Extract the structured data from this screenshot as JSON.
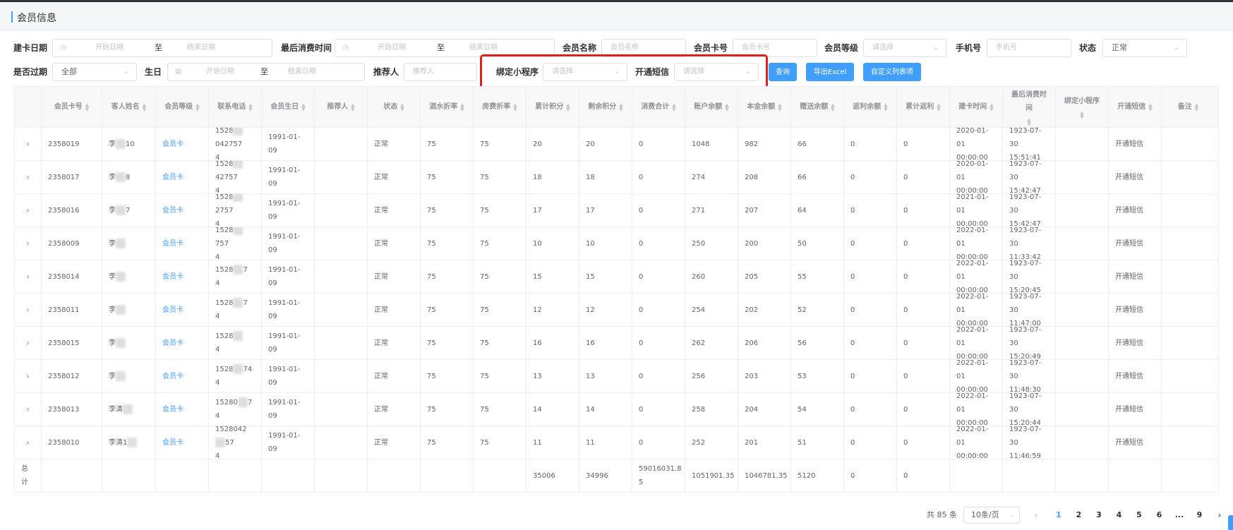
{
  "page": {
    "title": "会员信息"
  },
  "filters": {
    "card_date": {
      "label": "建卡日期",
      "start": "开始日期",
      "sep": "至",
      "end": "结束日期"
    },
    "last_consume": {
      "label": "最后消费时间",
      "start": "开始日期",
      "sep": "至",
      "end": "结束日期"
    },
    "member_name": {
      "label": "会员名称",
      "placeholder": "会员名称"
    },
    "card_no": {
      "label": "会员卡号",
      "placeholder": "会员卡号"
    },
    "level": {
      "label": "会员等级",
      "placeholder": "请选择"
    },
    "phone": {
      "label": "手机号",
      "placeholder": "手机号"
    },
    "status": {
      "label": "状态",
      "value": "正常"
    },
    "expired": {
      "label": "是否过期",
      "value": "全部"
    },
    "birthday": {
      "label": "生日",
      "start": "开始日期",
      "sep": "至",
      "end": "结束日期"
    },
    "referrer": {
      "label": "推荐人",
      "placeholder": "推荐人"
    },
    "mini_program": {
      "label": "绑定小程序",
      "placeholder": "请选择"
    },
    "sms": {
      "label": "开通短信",
      "placeholder": "请选择"
    }
  },
  "buttons": {
    "query": "查询",
    "export": "导出Excel",
    "custom_cols": "自定义列表项"
  },
  "table": {
    "headers": {
      "card_no": "会员卡号",
      "name": "客人姓名",
      "level": "会员等级",
      "phone": "联系电话",
      "birthday": "会员生日",
      "referrer": "推荐人",
      "status": "状态",
      "drink_discount": "酒水折率",
      "room_discount": "房费折率",
      "points_total": "累计积分",
      "points_left": "剩余积分",
      "consume_total": "消费合计",
      "account_balance": "账户余额",
      "principal_balance": "本金余额",
      "gift_balance": "赠送余额",
      "rebate_balance": "返利余额",
      "rebate_total": "累计返利",
      "card_time": "建卡时间",
      "last_consume_time": "最后消费时间",
      "mini_program": "绑定小程序",
      "sms": "开通短信",
      "remark": "备注"
    },
    "rows": [
      {
        "card_no": "2358019",
        "name_a": "李",
        "name_b": "10",
        "level": "会员卡",
        "phone_a": "1528",
        "phone_b": "042757",
        "phone_c": "4",
        "birthday": "1991-01-09",
        "status": "正常",
        "drink": "75",
        "room": "75",
        "pts_total": "20",
        "pts_left": "20",
        "consume": "0",
        "account": "1048",
        "principal": "982",
        "gift": "66",
        "rebate": "0",
        "rebate_total": "0",
        "card_time_a": "2020-01-01",
        "card_time_b": "00:00:00",
        "last_a": "1923-07-30",
        "last_b": "15:51:41",
        "sms": "开通短信"
      },
      {
        "card_no": "2358017",
        "name_a": "李",
        "name_b": "8",
        "level": "会员卡",
        "phone_a": "1528",
        "phone_b": "42757",
        "phone_c": "4",
        "birthday": "1991-01-09",
        "status": "正常",
        "drink": "75",
        "room": "75",
        "pts_total": "18",
        "pts_left": "18",
        "consume": "0",
        "account": "274",
        "principal": "208",
        "gift": "66",
        "rebate": "0",
        "rebate_total": "0",
        "card_time_a": "2020-01-01",
        "card_time_b": "00:00:00",
        "last_a": "1923-07-30",
        "last_b": "15:42:47",
        "sms": "开通短信"
      },
      {
        "card_no": "2358016",
        "name_a": "李",
        "name_b": "7",
        "level": "会员卡",
        "phone_a": "1528",
        "phone_b": "2757",
        "phone_c": "4",
        "birthday": "1991-01-09",
        "status": "正常",
        "drink": "75",
        "room": "75",
        "pts_total": "17",
        "pts_left": "17",
        "consume": "0",
        "account": "271",
        "principal": "207",
        "gift": "64",
        "rebate": "0",
        "rebate_total": "0",
        "card_time_a": "2021-01-01",
        "card_time_b": "00:00:00",
        "last_a": "1923-07-30",
        "last_b": "15:42:47",
        "sms": "开通短信"
      },
      {
        "card_no": "2358009",
        "name_a": "李",
        "name_b": "",
        "level": "会员卡",
        "phone_a": "1528",
        "phone_b": "757",
        "phone_c": "4",
        "birthday": "1991-01-09",
        "status": "正常",
        "drink": "75",
        "room": "75",
        "pts_total": "10",
        "pts_left": "10",
        "consume": "0",
        "account": "250",
        "principal": "200",
        "gift": "50",
        "rebate": "0",
        "rebate_total": "0",
        "card_time_a": "2022-01-01",
        "card_time_b": "00:00:00",
        "last_a": "1923-07-30",
        "last_b": "11:33:42",
        "sms": "开通短信"
      },
      {
        "card_no": "2358014",
        "name_a": "李",
        "name_b": "",
        "level": "会员卡",
        "phone_a": "1528",
        "phone_b": "7",
        "phone_c": "4",
        "birthday": "1991-01-09",
        "status": "正常",
        "drink": "75",
        "room": "75",
        "pts_total": "15",
        "pts_left": "15",
        "consume": "0",
        "account": "260",
        "principal": "205",
        "gift": "55",
        "rebate": "0",
        "rebate_total": "0",
        "card_time_a": "2022-01-01",
        "card_time_b": "00:00:00",
        "last_a": "1923-07-30",
        "last_b": "15:20:45",
        "sms": "开通短信"
      },
      {
        "card_no": "2358011",
        "name_a": "李",
        "name_b": "",
        "level": "会员卡",
        "phone_a": "1528",
        "phone_b": "7",
        "phone_c": "4",
        "birthday": "1991-01-09",
        "status": "正常",
        "drink": "75",
        "room": "75",
        "pts_total": "12",
        "pts_left": "12",
        "consume": "0",
        "account": "254",
        "principal": "202",
        "gift": "52",
        "rebate": "0",
        "rebate_total": "0",
        "card_time_a": "2022-01-01",
        "card_time_b": "00:00:00",
        "last_a": "1923-07-30",
        "last_b": "11:47:00",
        "sms": "开通短信"
      },
      {
        "card_no": "2358015",
        "name_a": "李",
        "name_b": "",
        "level": "会员卡",
        "phone_a": "1528",
        "phone_b": "",
        "phone_c": "4",
        "birthday": "1991-01-09",
        "status": "正常",
        "drink": "75",
        "room": "75",
        "pts_total": "16",
        "pts_left": "16",
        "consume": "0",
        "account": "262",
        "principal": "206",
        "gift": "56",
        "rebate": "0",
        "rebate_total": "0",
        "card_time_a": "2022-01-01",
        "card_time_b": "00:00:00",
        "last_a": "1923-07-30",
        "last_b": "15:20:49",
        "sms": "开通短信"
      },
      {
        "card_no": "2358012",
        "name_a": "李",
        "name_b": "",
        "level": "会员卡",
        "phone_a": "1528",
        "phone_b": "74",
        "phone_c": "4",
        "birthday": "1991-01-09",
        "status": "正常",
        "drink": "75",
        "room": "75",
        "pts_total": "13",
        "pts_left": "13",
        "consume": "0",
        "account": "256",
        "principal": "203",
        "gift": "53",
        "rebate": "0",
        "rebate_total": "0",
        "card_time_a": "2022-01-01",
        "card_time_b": "00:00:00",
        "last_a": "1923-07-30",
        "last_b": "11:48:30",
        "sms": "开通短信"
      },
      {
        "card_no": "2358013",
        "name_a": "李清",
        "name_b": "",
        "level": "会员卡",
        "phone_a": "15280",
        "phone_b": "7",
        "phone_c": "4",
        "birthday": "1991-01-09",
        "status": "正常",
        "drink": "75",
        "room": "75",
        "pts_total": "14",
        "pts_left": "14",
        "consume": "0",
        "account": "258",
        "principal": "204",
        "gift": "54",
        "rebate": "0",
        "rebate_total": "0",
        "card_time_a": "2022-01-01",
        "card_time_b": "00:00:00",
        "last_a": "1923-07-30",
        "last_b": "15:20:44",
        "sms": "开通短信"
      },
      {
        "card_no": "2358010",
        "name_a": "李清1",
        "name_b": "",
        "level": "会员卡",
        "phone_a": "1528042",
        "phone_b": "57",
        "phone_c": "4",
        "birthday": "1991-01-09",
        "status": "正常",
        "drink": "75",
        "room": "75",
        "pts_total": "11",
        "pts_left": "11",
        "consume": "0",
        "account": "252",
        "principal": "201",
        "gift": "51",
        "rebate": "0",
        "rebate_total": "0",
        "card_time_a": "2022-01-01",
        "card_time_b": "00:00:00",
        "last_a": "1923-07-30",
        "last_b": "11:46:59",
        "sms": "开通短信"
      }
    ],
    "summary": {
      "label": "总计",
      "pts_total": "35006",
      "pts_left": "34996",
      "consume_a": "59016031.8",
      "consume_b": "5",
      "account": "1051901.35",
      "principal": "1046781.35",
      "gift": "5120",
      "rebate": "0",
      "rebate_total": "0"
    }
  },
  "pagination": {
    "total": "共 85 条",
    "page_size": "10条/页",
    "pages": [
      "1",
      "2",
      "3",
      "4",
      "5",
      "6",
      "...",
      "9"
    ],
    "current": "1",
    "prev": "‹",
    "next": "›"
  }
}
